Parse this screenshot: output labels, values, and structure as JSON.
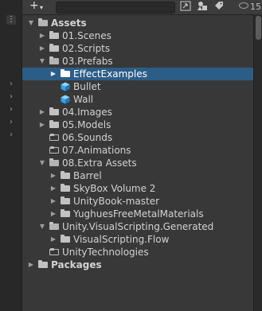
{
  "toolbar": {
    "add_label": "+",
    "add_caret": "▾",
    "hidden_count": "15",
    "icons": [
      "scene-picker-icon",
      "type-filter-icon",
      "label-filter-icon",
      "hidden-packages-icon"
    ]
  },
  "left_panel": {
    "menu_label": "⋮"
  },
  "tree": [
    {
      "label": "Assets",
      "depth": 0,
      "expanded": true,
      "has_children": true,
      "icon": "folder-open-icon",
      "bold": true
    },
    {
      "label": "01.Scenes",
      "depth": 1,
      "expanded": false,
      "has_children": true,
      "icon": "folder-icon"
    },
    {
      "label": "02.Scripts",
      "depth": 1,
      "expanded": false,
      "has_children": true,
      "icon": "folder-icon"
    },
    {
      "label": "03.Prefabs",
      "depth": 1,
      "expanded": true,
      "has_children": true,
      "icon": "folder-open-icon"
    },
    {
      "label": "EffectExamples",
      "depth": 2,
      "expanded": false,
      "has_children": true,
      "icon": "folder-icon",
      "selected": true
    },
    {
      "label": "Bullet",
      "depth": 2,
      "expanded": false,
      "has_children": false,
      "icon": "prefab-cube-icon"
    },
    {
      "label": "Wall",
      "depth": 2,
      "expanded": false,
      "has_children": false,
      "icon": "prefab-cube-icon"
    },
    {
      "label": "04.Images",
      "depth": 1,
      "expanded": false,
      "has_children": true,
      "icon": "folder-icon"
    },
    {
      "label": "05.Models",
      "depth": 1,
      "expanded": false,
      "has_children": true,
      "icon": "folder-icon"
    },
    {
      "label": "06.Sounds",
      "depth": 1,
      "expanded": false,
      "has_children": false,
      "icon": "folder-empty-icon"
    },
    {
      "label": "07.Animations",
      "depth": 1,
      "expanded": false,
      "has_children": false,
      "icon": "folder-empty-icon"
    },
    {
      "label": "08.Extra Assets",
      "depth": 1,
      "expanded": true,
      "has_children": true,
      "icon": "folder-open-icon"
    },
    {
      "label": "Barrel",
      "depth": 2,
      "expanded": false,
      "has_children": true,
      "icon": "folder-icon"
    },
    {
      "label": "SkyBox Volume 2",
      "depth": 2,
      "expanded": false,
      "has_children": true,
      "icon": "folder-icon"
    },
    {
      "label": "UnityBook-master",
      "depth": 2,
      "expanded": false,
      "has_children": true,
      "icon": "folder-icon"
    },
    {
      "label": "YughuesFreeMetalMaterials",
      "depth": 2,
      "expanded": false,
      "has_children": true,
      "icon": "folder-icon"
    },
    {
      "label": "Unity.VisualScripting.Generated",
      "depth": 1,
      "expanded": true,
      "has_children": true,
      "icon": "folder-open-icon"
    },
    {
      "label": "VisualScripting.Flow",
      "depth": 2,
      "expanded": false,
      "has_children": true,
      "icon": "folder-icon"
    },
    {
      "label": "UnityTechnologies",
      "depth": 1,
      "expanded": false,
      "has_children": false,
      "icon": "folder-empty-icon"
    },
    {
      "label": "Packages",
      "depth": 0,
      "expanded": false,
      "has_children": true,
      "icon": "folder-icon",
      "bold": true
    }
  ]
}
